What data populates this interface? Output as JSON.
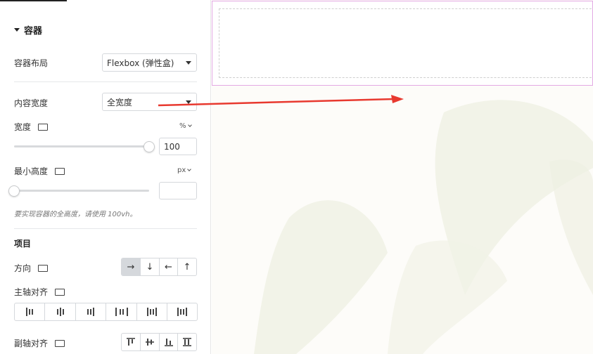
{
  "panel": {
    "section_title": "容器",
    "layout": {
      "label": "容器布局",
      "value": "Flexbox (弹性盒)"
    },
    "content_width": {
      "label": "内容宽度",
      "value": "全宽度"
    },
    "width": {
      "label": "宽度",
      "unit": "%",
      "value": "100",
      "level": 1.0
    },
    "min_height": {
      "label": "最小高度",
      "unit": "px",
      "value": "",
      "level": 0.0
    },
    "hint": "要实现容器的全高度，请使用 100vh。",
    "items_title": "项目",
    "direction": {
      "label": "方向",
      "options": [
        "→",
        "↓",
        "←",
        "↑"
      ],
      "active_index": 0
    },
    "justify": {
      "label": "主轴对齐",
      "icons": [
        "justify-start-icon",
        "justify-center-icon",
        "justify-end-icon",
        "justify-space-between-icon",
        "justify-space-around-icon",
        "justify-space-evenly-icon"
      ]
    },
    "align": {
      "label": "副轴对齐",
      "icons": [
        "align-start-icon",
        "align-center-icon",
        "align-end-icon",
        "align-stretch-icon"
      ]
    }
  },
  "colors": {
    "container_outline": "#e3a9e4",
    "annotation_arrow": "#e8392f",
    "active_segment": "#d5d8dc"
  }
}
